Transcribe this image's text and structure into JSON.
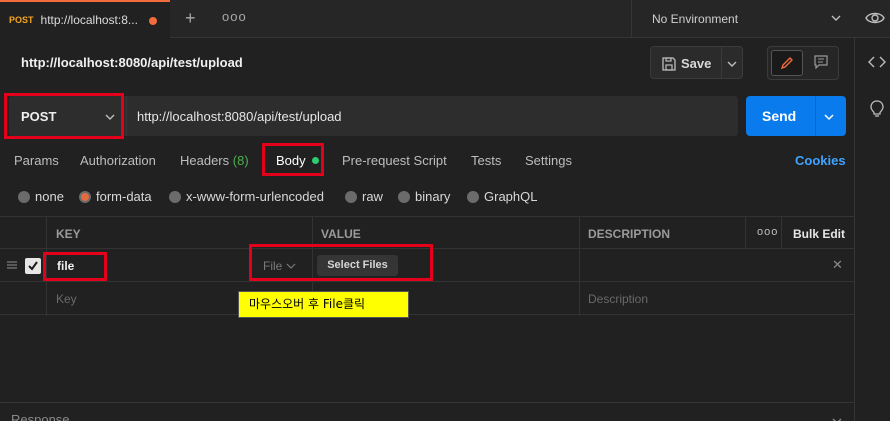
{
  "tabs": {
    "active": {
      "method": "POST",
      "url": "http://localhost:8..."
    },
    "new_tab_glyph": "+",
    "more_glyph": "ooo"
  },
  "environment": {
    "label": "No Environment"
  },
  "request": {
    "title": "http://localhost:8080/api/test/upload",
    "method": "POST",
    "url": "http://localhost:8080/api/test/upload",
    "save_label": "Save",
    "send_label": "Send"
  },
  "request_tabs": {
    "params": "Params",
    "authorization": "Authorization",
    "headers": "Headers",
    "headers_count": "(8)",
    "body": "Body",
    "prerequest": "Pre-request Script",
    "tests": "Tests",
    "settings": "Settings",
    "cookies": "Cookies"
  },
  "body_types": [
    "none",
    "form-data",
    "x-www-form-urlencoded",
    "raw",
    "binary",
    "GraphQL"
  ],
  "selected_body_type": "form-data",
  "table": {
    "headers": {
      "key": "KEY",
      "value": "VALUE",
      "description": "DESCRIPTION",
      "more": "ooo",
      "bulk_edit": "Bulk Edit"
    },
    "rows": [
      {
        "key": "file",
        "type": "File",
        "value_button": "Select Files",
        "checked": true
      }
    ],
    "placeholders": {
      "key": "Key",
      "description": "Description"
    }
  },
  "annotation": "마우스오버 후 File클릭",
  "response": {
    "label": "Response"
  },
  "colors": {
    "accent": "#f26b3a",
    "send": "#097bed",
    "highlight": "#e2001a",
    "tooltip": "#ffff00"
  }
}
